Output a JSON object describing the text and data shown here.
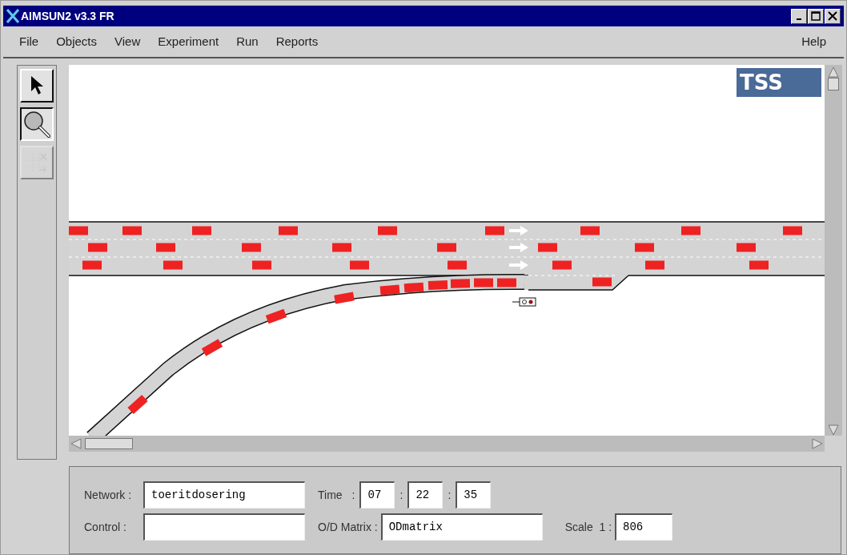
{
  "window": {
    "title": "AIMSUN2 v3.3 FR"
  },
  "menu": [
    "File",
    "Objects",
    "View",
    "Experiment",
    "Run",
    "Reports"
  ],
  "help_menu": "Help",
  "tools": [
    {
      "kind": "pointer",
      "selected": false,
      "disabled": false
    },
    {
      "kind": "zoom",
      "selected": true,
      "disabled": false
    },
    {
      "kind": "matrix",
      "selected": false,
      "disabled": true
    }
  ],
  "canvas": {
    "logo": "TSS"
  },
  "form": {
    "network": {
      "label": "Network :",
      "value": "toeritdosering"
    },
    "time": {
      "label": "Time",
      "separators": [
        ":",
        ":",
        ":"
      ],
      "values": [
        "07",
        "22",
        "35"
      ]
    },
    "control": {
      "label": "Control :"
    },
    "od_matrix": {
      "label": "O/D Matrix :",
      "value": "ODmatrix"
    },
    "scale": {
      "label": "Scale  1 :",
      "value": "806"
    }
  }
}
